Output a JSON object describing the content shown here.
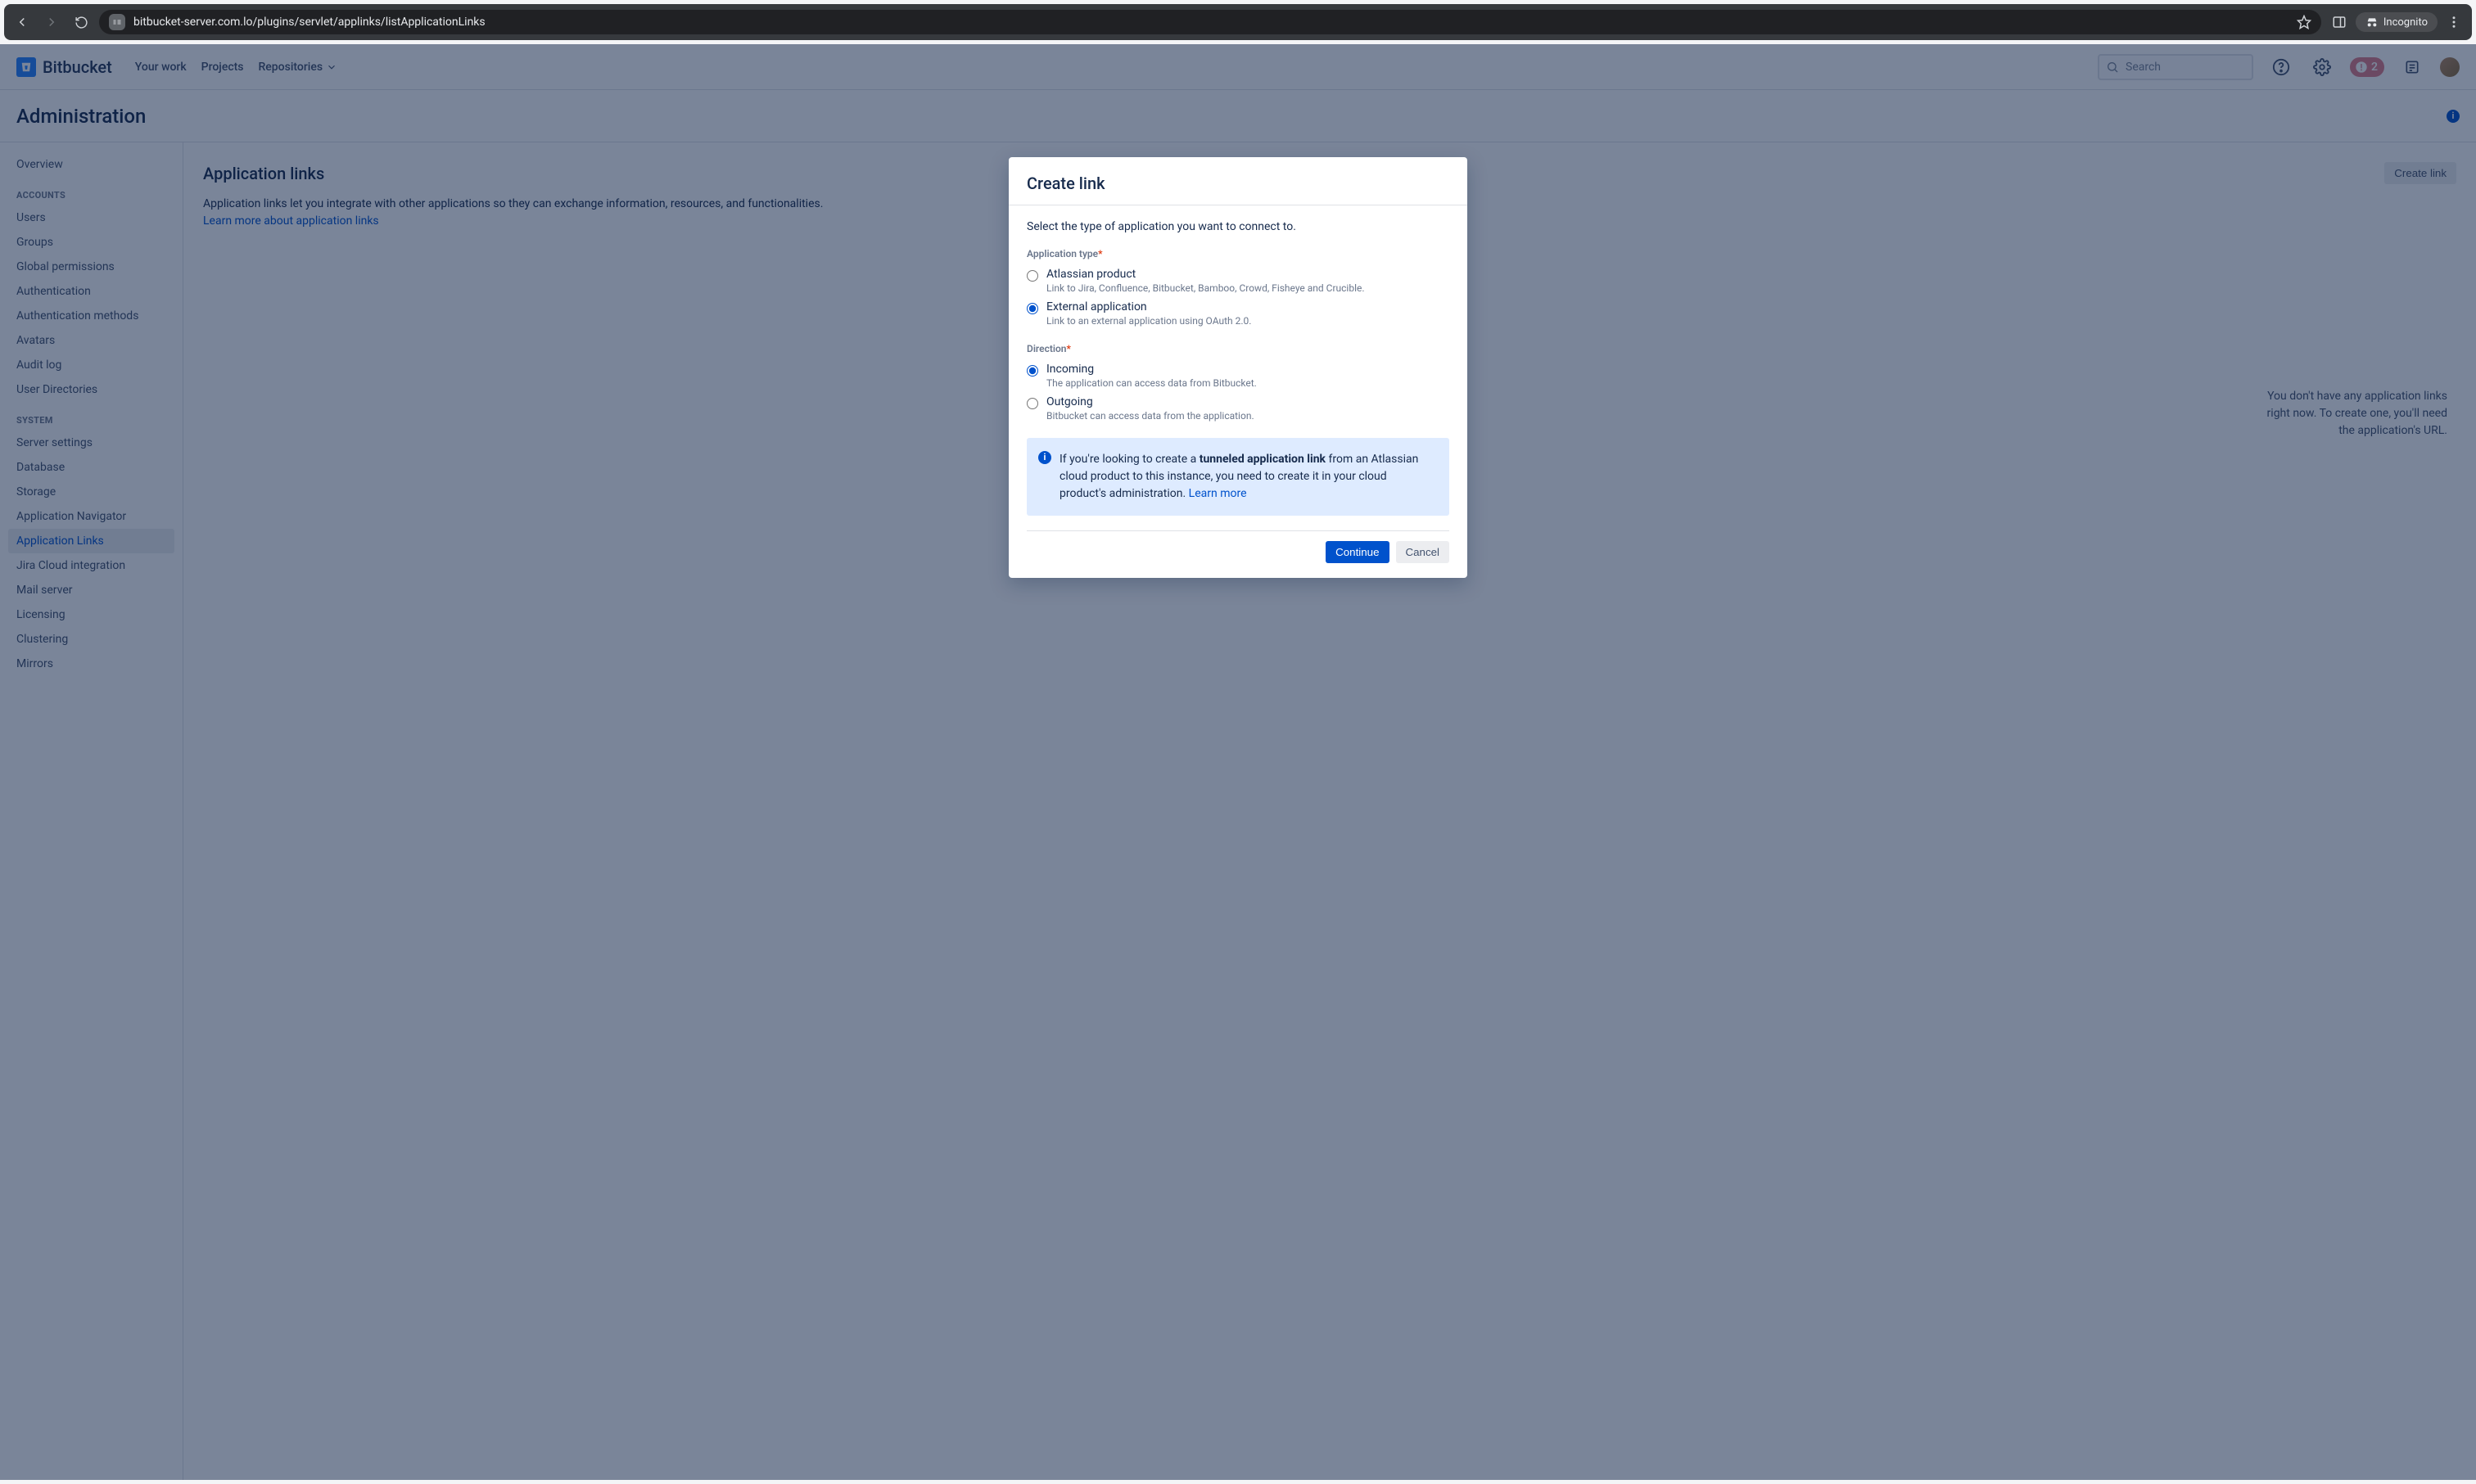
{
  "browser": {
    "url": "bitbucket-server.com.lo/plugins/servlet/applinks/listApplicationLinks",
    "incognito_label": "Incognito"
  },
  "nav": {
    "brand": "Bitbucket",
    "links": {
      "your_work": "Your work",
      "projects": "Projects",
      "repositories": "Repositories"
    },
    "search_placeholder": "Search",
    "notif_count": "2"
  },
  "admin_title": "Administration",
  "sidebar": {
    "overview": "Overview",
    "heading_accounts": "ACCOUNTS",
    "accounts": {
      "users": "Users",
      "groups": "Groups",
      "global_permissions": "Global permissions",
      "authentication": "Authentication",
      "authentication_methods": "Authentication methods",
      "avatars": "Avatars",
      "audit_log": "Audit log",
      "user_directories": "User Directories"
    },
    "heading_system": "SYSTEM",
    "system": {
      "server_settings": "Server settings",
      "database": "Database",
      "storage": "Storage",
      "application_navigator": "Application Navigator",
      "application_links": "Application Links",
      "jira_cloud_integration": "Jira Cloud integration",
      "mail_server": "Mail server",
      "licensing": "Licensing",
      "clustering": "Clustering",
      "mirrors": "Mirrors"
    }
  },
  "main": {
    "title": "Application links",
    "desc_part1": "Application links let you integrate with other applications so they can exchange information, resources, and functionalities. ",
    "learn_more": "Learn more about application links",
    "create_link": "Create link",
    "empty_hint_1": "You don't have any application links right now. To create one, you'll need the application's URL."
  },
  "modal": {
    "title": "Create link",
    "lead": "Select the type of application you want to connect to.",
    "app_type_label": "Application type",
    "option_atlassian": "Atlassian product",
    "option_atlassian_sub": "Link to Jira, Confluence, Bitbucket, Bamboo, Crowd, Fisheye and Crucible.",
    "option_external": "External application",
    "option_external_sub": "Link to an external application using OAuth 2.0.",
    "direction_label": "Direction",
    "option_incoming": "Incoming",
    "option_incoming_sub": "The application can access data from Bitbucket.",
    "option_outgoing": "Outgoing",
    "option_outgoing_sub": "Bitbucket can access data from the application.",
    "info_prefix": "If you're looking to create a ",
    "info_bold": "tunneled application link",
    "info_suffix": " from an Atlassian cloud product to this instance, you need to create it in your cloud product's administration. ",
    "info_learn_more": "Learn more",
    "continue": "Continue",
    "cancel": "Cancel"
  }
}
